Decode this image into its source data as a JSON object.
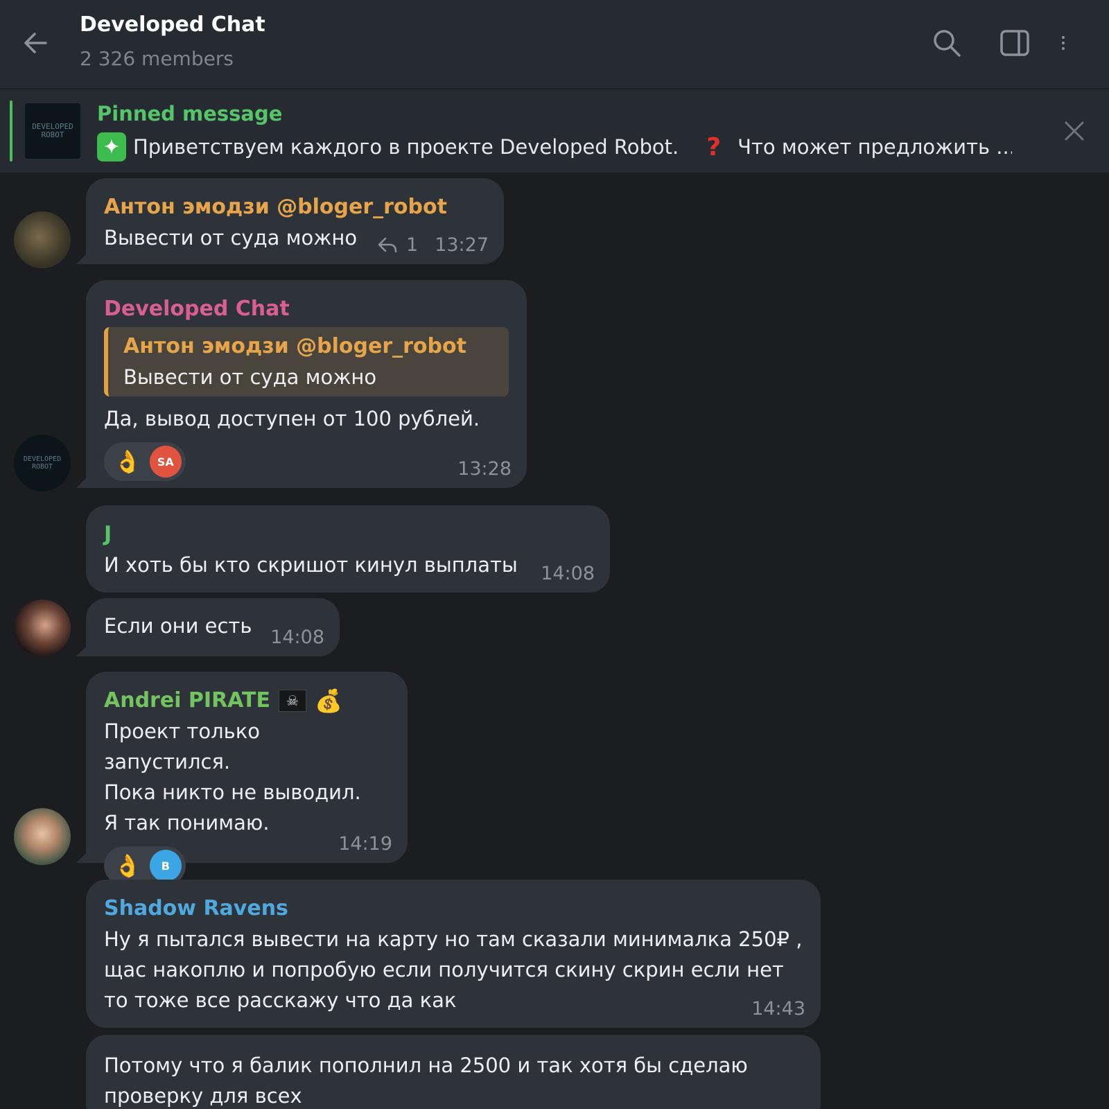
{
  "header": {
    "title": "Developed Chat",
    "subtitle": "2 326 members"
  },
  "pinned": {
    "label": "Pinned message",
    "thumb_text": "DEVELOPED ROBOT",
    "text1": "Приветствуем каждого в проекте Developed Robot.",
    "text2": "Что может предложить ..."
  },
  "messages": [
    {
      "sender": "Антон эмодзи @bloger_robot",
      "sender_color": "#e6a54a",
      "text": "Вывести от суда можно",
      "reply_count": "1",
      "time": "13:27"
    },
    {
      "sender": "Developed Chat",
      "sender_color": "#d95f91",
      "quote_sender": "Антон эмодзи @bloger_robot",
      "quote_text": "Вывести от суда можно",
      "text": "Да, вывод доступен от 100 рублей.",
      "reaction_avatar": "SA",
      "time": "13:28"
    },
    {
      "sender": "J",
      "sender_color": "#56c469",
      "text": "И хоть бы кто скришот кинул выплаты",
      "time": "14:08"
    },
    {
      "text": "Если они есть",
      "time": "14:08"
    },
    {
      "sender": "Andrei PIRATE",
      "sender_color": "#73c460",
      "lines": [
        "Проект только запустился.",
        "Пока никто не выводил.",
        "Я так понимаю."
      ],
      "reaction_avatar": "B",
      "time": "14:19"
    },
    {
      "sender": "Shadow Ravens",
      "sender_color": "#4fa9de",
      "lines": [
        "Ну я пытался вывести на карту но там сказали минималка 250₽ ,",
        "щас накоплю и попробую если получится скину скрин если нет",
        "то тоже все расскажу что да как"
      ],
      "time": "14:43"
    },
    {
      "lines": [
        "Потому что я балик пополнил на 2500 и так хотя бы сделаю",
        "проверку для всех"
      ]
    }
  ]
}
